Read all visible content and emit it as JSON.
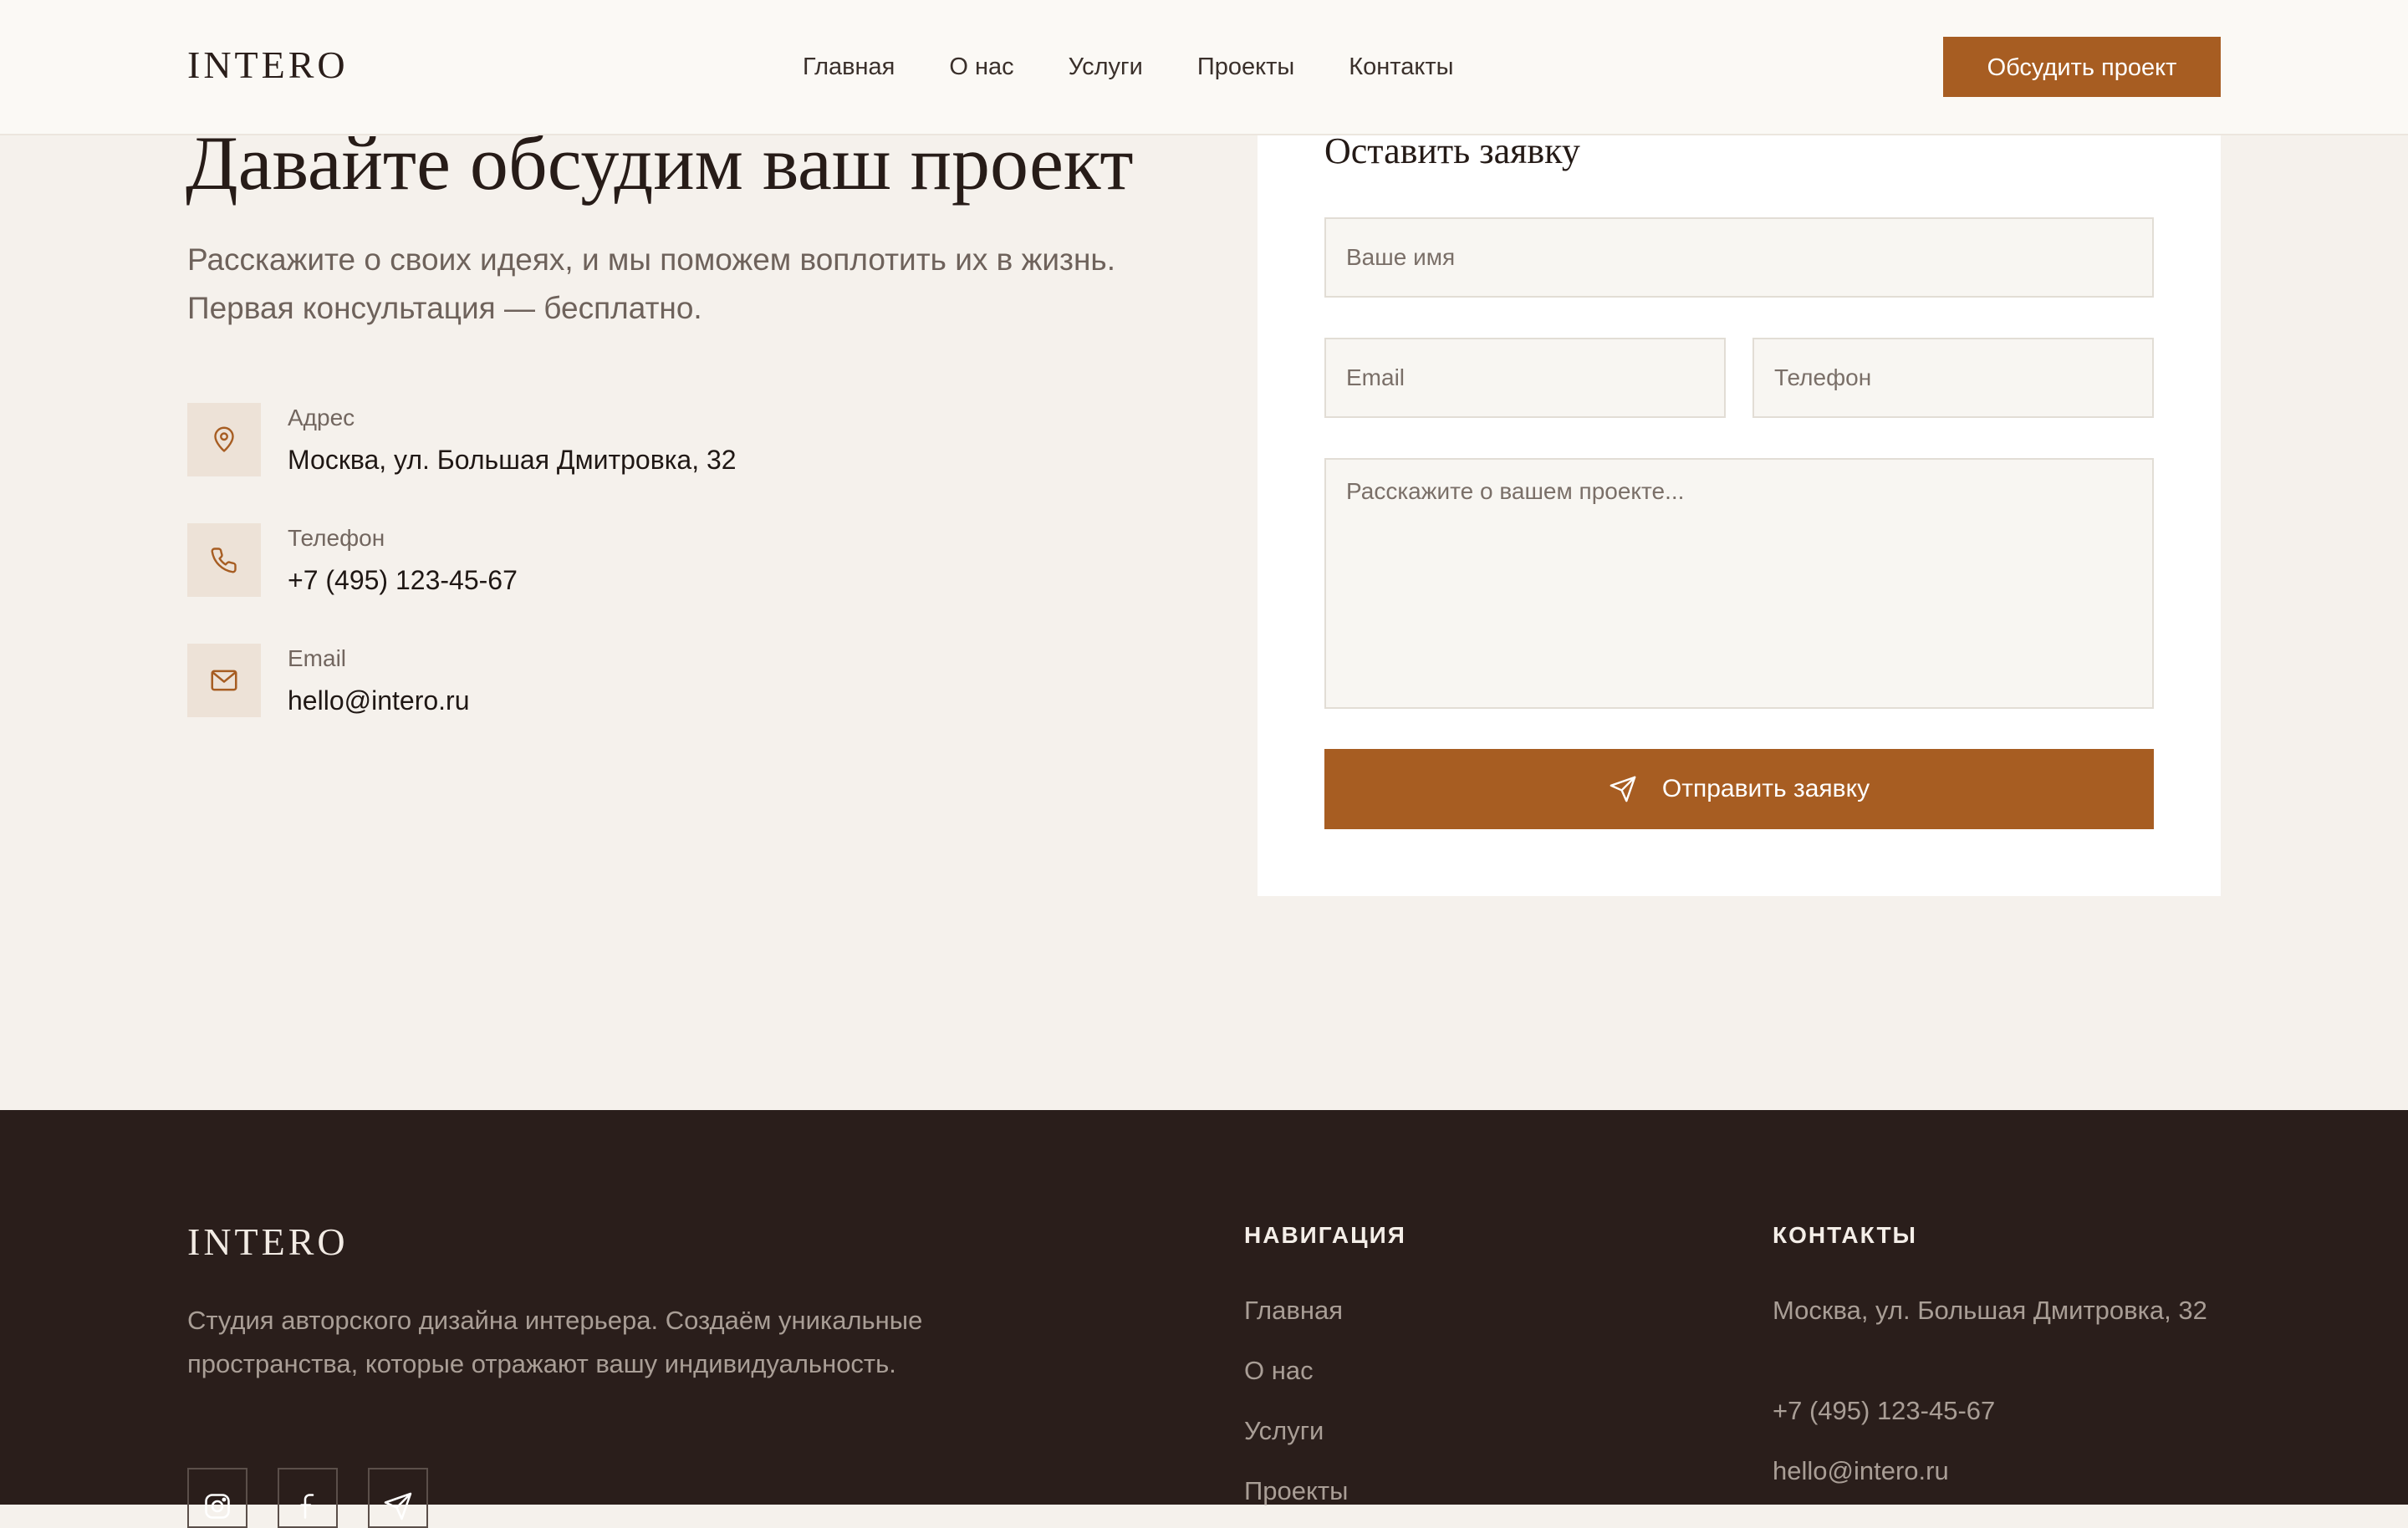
{
  "header": {
    "logo": "INTERO",
    "nav": [
      "Главная",
      "О нас",
      "Услуги",
      "Проекты",
      "Контакты"
    ],
    "cta_label": "Обсудить проект"
  },
  "hero": {
    "title": "Давайте обсудим ваш проект",
    "subtitle": "Расскажите о своих идеях, и мы поможем воплотить их в жизнь. Первая консультация — бесплатно."
  },
  "contacts": [
    {
      "label": "Адрес",
      "value": "Москва, ул. Большая Дмитровка, 32",
      "icon": "map-pin-icon"
    },
    {
      "label": "Телефон",
      "value": "+7 (495) 123-45-67",
      "icon": "phone-icon"
    },
    {
      "label": "Email",
      "value": "hello@intero.ru",
      "icon": "mail-icon"
    }
  ],
  "form": {
    "title": "Оставить заявку",
    "name_placeholder": "Ваше имя",
    "email_placeholder": "Email",
    "phone_placeholder": "Телефон",
    "message_placeholder": "Расскажите о вашем проекте...",
    "submit_label": "Отправить заявку"
  },
  "footer": {
    "logo": "INTERO",
    "description": "Студия авторского дизайна интерьера. Создаём уникальные пространства, которые отражают вашу индивидуальность.",
    "social": [
      "instagram-icon",
      "facebook-icon",
      "telegram-icon"
    ],
    "nav_heading": "НАВИГАЦИЯ",
    "nav_links": [
      "Главная",
      "О нас",
      "Услуги",
      "Проекты"
    ],
    "contacts_heading": "КОНТАКТЫ",
    "address": "Москва, ул. Большая Дмитровка, 32",
    "phone": "+7 (495) 123-45-67",
    "email": "hello@intero.ru"
  },
  "colors": {
    "accent": "#a75d22",
    "background": "#f5f1ec",
    "footer_bg": "#2a1e1b",
    "icon_tile": "#ede2d7"
  }
}
